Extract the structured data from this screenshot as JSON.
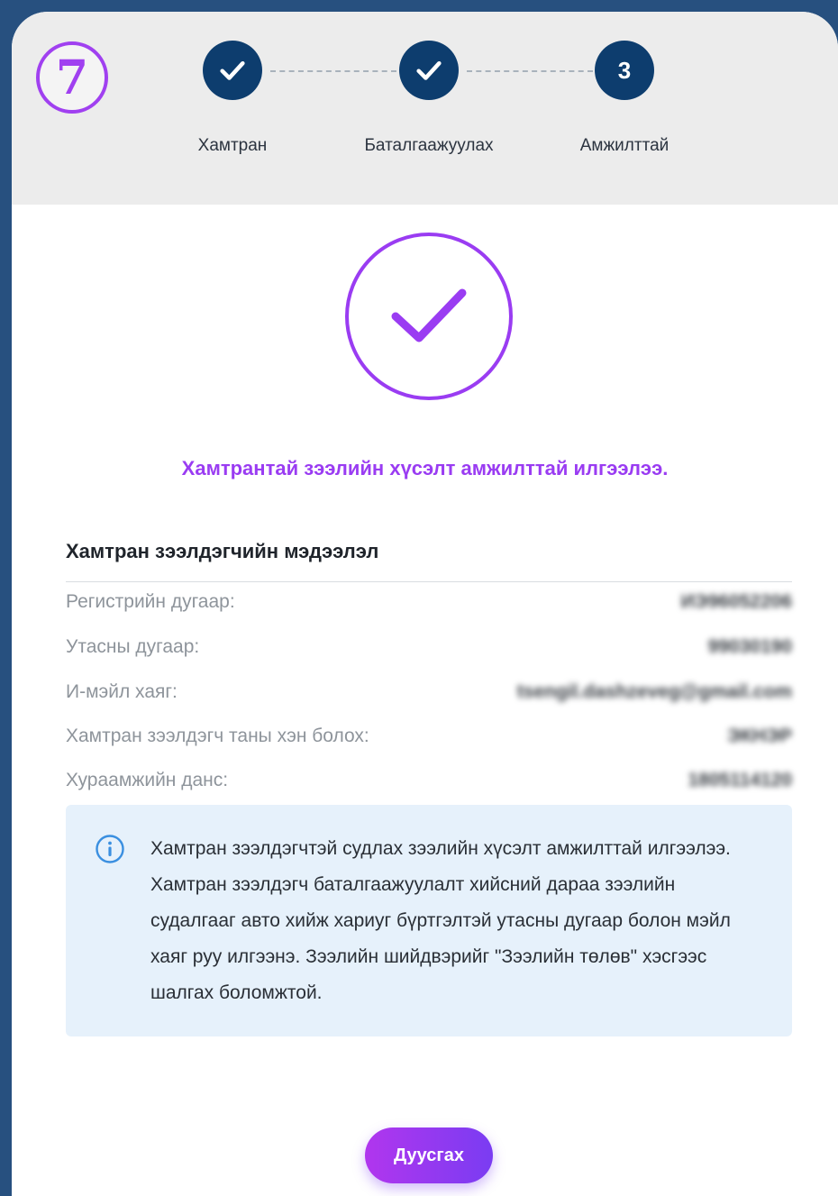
{
  "step_badge": "7",
  "stepper": {
    "steps": [
      {
        "label": "Хамтран",
        "state": "done"
      },
      {
        "label": "Баталгаажуулах",
        "state": "done"
      },
      {
        "label": "Амжилттай",
        "number": "3",
        "state": "active"
      }
    ]
  },
  "success": {
    "message": "Хамтрантай зээлийн хүсэлт амжилттай илгээлээ."
  },
  "details": {
    "title": "Хамтран зээлдэгчийн мэдээлэл",
    "rows": [
      {
        "label": "Регистрийн дугаар:",
        "value": "ИЭ96052206"
      },
      {
        "label": "Утасны дугаар:",
        "value": "99030190"
      },
      {
        "label": "И-мэйл хаяг:",
        "value": "tsengil.dashzeveg@gmail.com"
      },
      {
        "label": "Хамтран зээлдэгч таны хэн болох:",
        "value": "ЭКНЭР"
      },
      {
        "label": "Хураамжийн данс:",
        "value": "1805114120"
      }
    ]
  },
  "notice": {
    "text": "Хамтран зээлдэгчтэй судлах зээлийн хүсэлт амжилттай илгээлээ. Хамтран зээлдэгч баталгаажуулалт хийсний дараа зээлийн судалгааг авто хийж хариуг бүртгэлтэй утасны дугаар болон мэйл хаяг руу илгээнэ. Зээлийн шийдвэрийг \"Зээлийн төлөв\" хэсгээс шалгах боломжтой."
  },
  "actions": {
    "finish_label": "Дуусгах"
  },
  "colors": {
    "accent": "#9a3cf2",
    "step_done": "#0d3d6e",
    "background": "#27507f",
    "notice_bg": "#e6f1fb"
  }
}
